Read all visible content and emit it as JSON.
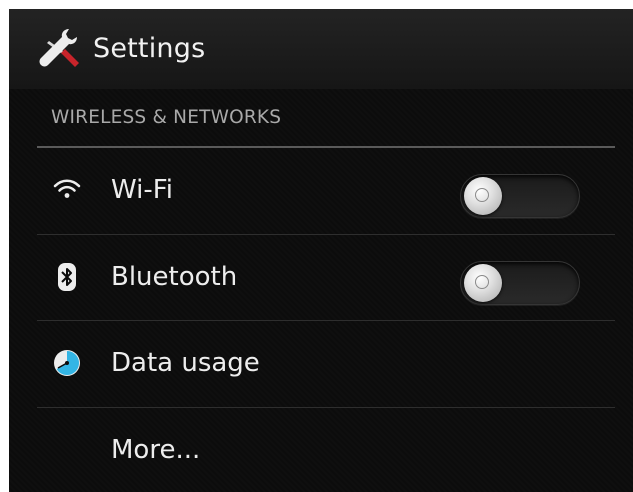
{
  "action_bar": {
    "title": "Settings",
    "icon": "settings-tools-icon"
  },
  "section": {
    "header": "WIRELESS & NETWORKS"
  },
  "items": [
    {
      "label": "Wi-Fi",
      "icon": "wifi-icon",
      "toggle": "off"
    },
    {
      "label": "Bluetooth",
      "icon": "bluetooth-icon",
      "toggle": "off"
    },
    {
      "label": "Data usage",
      "icon": "data-usage-icon"
    },
    {
      "label": "More..."
    }
  ],
  "colors": {
    "background": "#0b0b0b",
    "accent": "#33b5e5",
    "section_header": "#a9a9a9",
    "text": "#ededed"
  }
}
